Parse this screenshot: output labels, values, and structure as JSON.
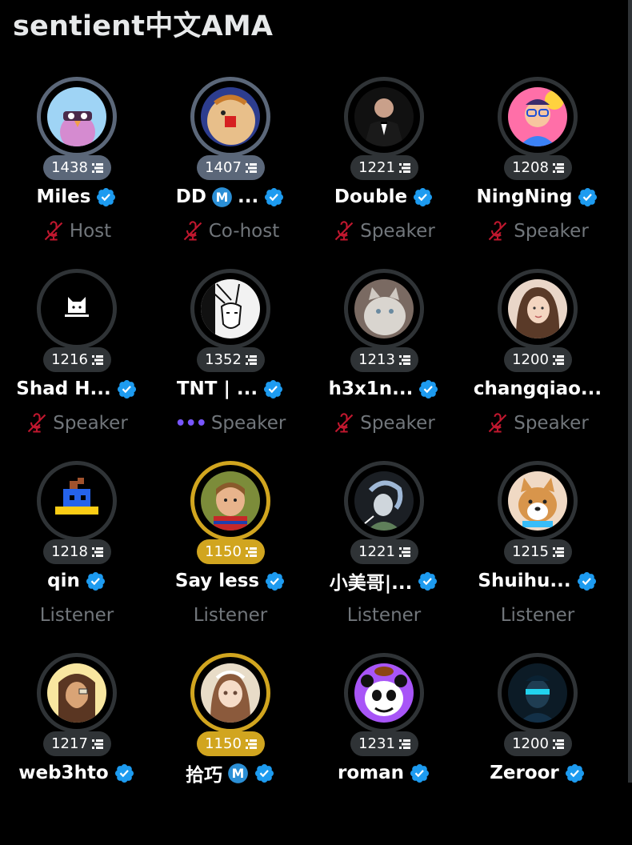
{
  "space": {
    "title": "sentient中文AMA"
  },
  "participants": [
    {
      "points": "1438",
      "name": "Miles",
      "verified": true,
      "m_badge": false,
      "role": "Host",
      "status_icon": "muted-mic-icon",
      "ring": "host"
    },
    {
      "points": "1407",
      "name": "DD",
      "name_suffix": "...",
      "verified": true,
      "m_badge": true,
      "role": "Co-host",
      "status_icon": "muted-mic-icon",
      "ring": "host"
    },
    {
      "points": "1221",
      "name": "Double",
      "verified": true,
      "m_badge": false,
      "role": "Speaker",
      "status_icon": "muted-mic-icon",
      "ring": "none"
    },
    {
      "points": "1208",
      "name": "NingNing",
      "verified": true,
      "m_badge": false,
      "role": "Speaker",
      "status_icon": "muted-mic-icon",
      "ring": "none"
    },
    {
      "points": "1216",
      "name": "Shad H...",
      "verified": true,
      "m_badge": false,
      "role": "Speaker",
      "status_icon": "muted-mic-icon",
      "ring": "none"
    },
    {
      "points": "1352",
      "name": "TNT | ...",
      "verified": true,
      "m_badge": false,
      "role": "Speaker",
      "status_icon": "speaking-dots-icon",
      "ring": "none"
    },
    {
      "points": "1213",
      "name": "h3x1n...",
      "verified": true,
      "m_badge": false,
      "role": "Speaker",
      "status_icon": "muted-mic-icon",
      "ring": "none"
    },
    {
      "points": "1200",
      "name": "changqiao...",
      "verified": false,
      "m_badge": false,
      "role": "Speaker",
      "status_icon": "muted-mic-icon",
      "ring": "none"
    },
    {
      "points": "1218",
      "name": "qin",
      "verified": true,
      "m_badge": false,
      "role": "Listener",
      "status_icon": "",
      "ring": "none"
    },
    {
      "points": "1150",
      "name": "Say less",
      "verified": true,
      "m_badge": false,
      "role": "Listener",
      "status_icon": "",
      "ring": "gold"
    },
    {
      "points": "1221",
      "name": "小美哥|...",
      "verified": true,
      "m_badge": false,
      "role": "Listener",
      "status_icon": "",
      "ring": "none"
    },
    {
      "points": "1215",
      "name": "Shuihu...",
      "verified": true,
      "m_badge": false,
      "role": "Listener",
      "status_icon": "",
      "ring": "none"
    },
    {
      "points": "1217",
      "name": "web3hto",
      "verified": true,
      "m_badge": false,
      "role": "",
      "status_icon": "",
      "ring": "none"
    },
    {
      "points": "1150",
      "name": "拾巧",
      "verified": true,
      "m_badge": true,
      "role": "",
      "status_icon": "",
      "ring": "gold"
    },
    {
      "points": "1231",
      "name": "roman",
      "verified": true,
      "m_badge": false,
      "role": "",
      "status_icon": "",
      "ring": "none"
    },
    {
      "points": "1200",
      "name": "Zeroor",
      "verified": true,
      "m_badge": false,
      "role": "",
      "status_icon": "",
      "ring": "none"
    }
  ],
  "colors": {
    "background": "#000000",
    "verified_badge": "#1d9bf0",
    "muted_mic": "#c0172e",
    "speaking_dots": "#7856ff",
    "host_ring": "#5b6779",
    "gold_ring": "#d1a51f",
    "default_ring": "#2f3336"
  }
}
